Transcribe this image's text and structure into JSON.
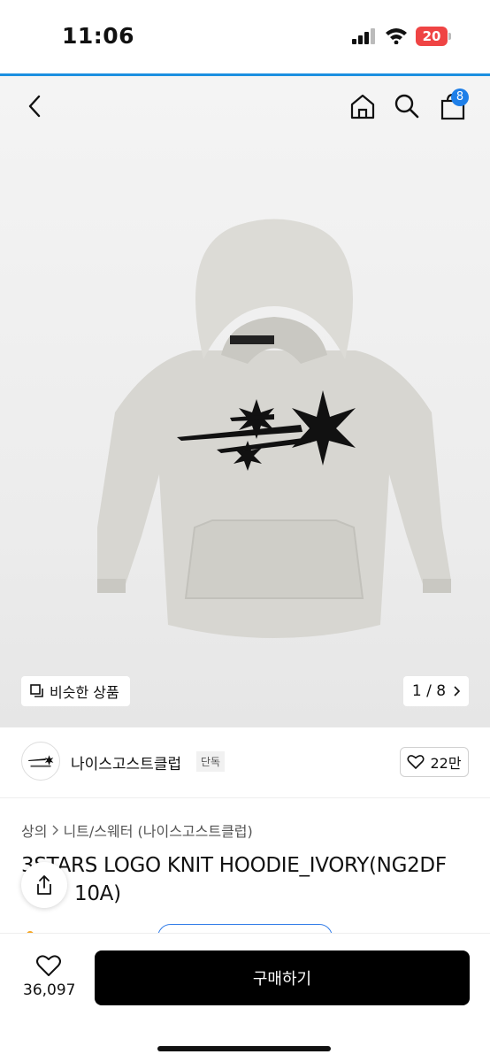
{
  "status": {
    "time": "11:06",
    "battery": "20"
  },
  "nav": {
    "cart_count": "8"
  },
  "product": {
    "similar_label": "비슷한 상품",
    "page_indicator": "1 / 8",
    "brand_name": "나이스고스트클럽",
    "brand_tag": "단독",
    "likes": "22만",
    "breadcrumb": [
      "상의",
      "니트/스웨터 (나이스고스트클럽)"
    ],
    "title": "3STARS LOGO KNIT HOODIE_IVORY(NG2DF",
    "title_line2": "10A)"
  },
  "bottom": {
    "wish_count": "36,097",
    "buy_label": "구매하기"
  },
  "colors": {
    "accent": "#1b8fe0",
    "badge": "#1e7fe8",
    "battery": "#ef4444",
    "buy": "#000000",
    "hoodie": "#d7d6d1"
  }
}
